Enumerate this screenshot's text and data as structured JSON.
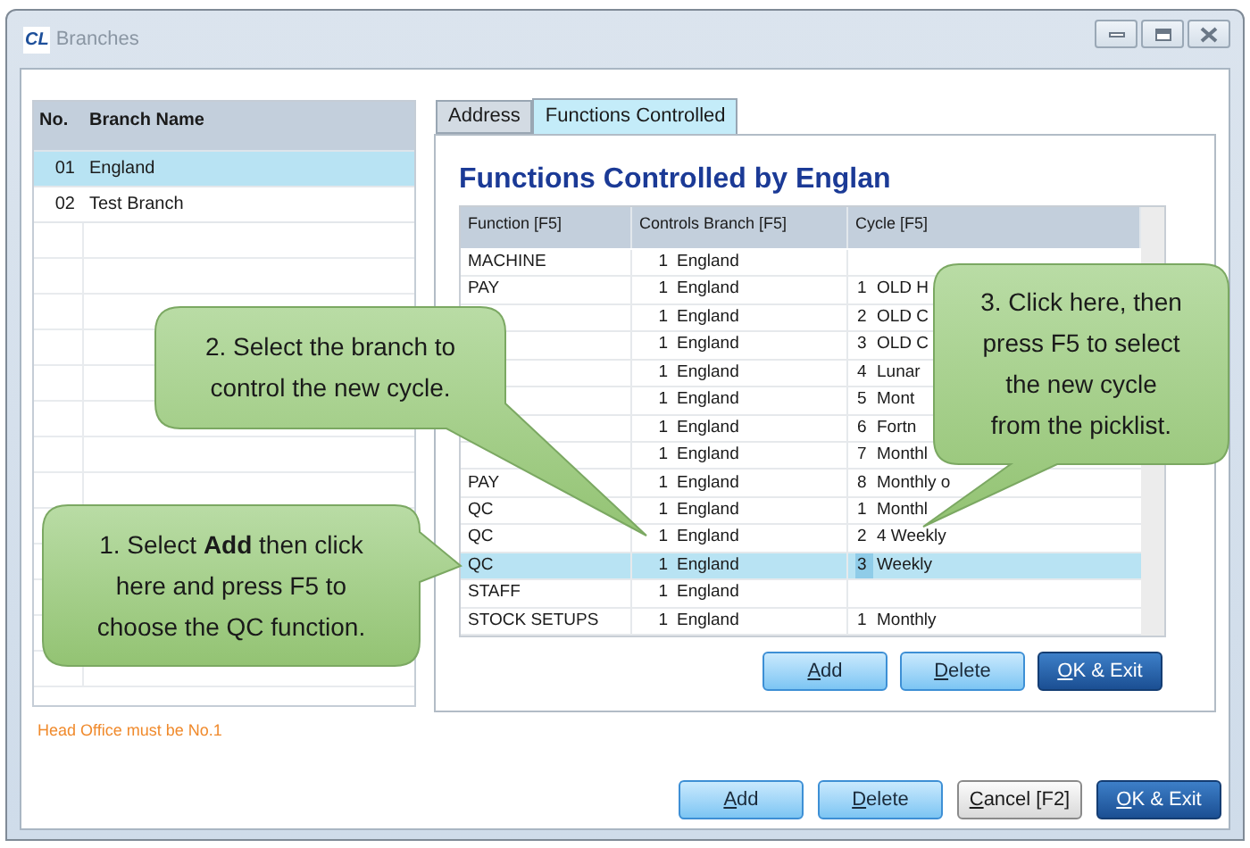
{
  "window": {
    "logo": "CL",
    "title": "Branches"
  },
  "branch_list": {
    "columns": [
      "No.",
      "Branch Name"
    ],
    "rows": [
      {
        "no": "01",
        "name": "England",
        "selected": true
      },
      {
        "no": "02",
        "name": "Test Branch",
        "selected": false
      }
    ]
  },
  "note": "Head Office must be No.1",
  "tabs": [
    {
      "label": "Address",
      "selected": false
    },
    {
      "label": "Functions Controlled",
      "selected": true
    }
  ],
  "heading": "Functions Controlled by Englan",
  "table": {
    "columns": [
      "Function [F5]",
      "Controls Branch [F5]",
      "Cycle [F5]"
    ],
    "rows": [
      {
        "function": "MACHINE",
        "branch_no": "1",
        "branch": "England",
        "cycle_no": "",
        "cycle": "",
        "selected": false
      },
      {
        "function": "PAY",
        "branch_no": "1",
        "branch": "England",
        "cycle_no": "1",
        "cycle": "OLD H",
        "selected": false
      },
      {
        "function": "",
        "branch_no": "1",
        "branch": "England",
        "cycle_no": "2",
        "cycle": "OLD C",
        "selected": false
      },
      {
        "function": "",
        "branch_no": "1",
        "branch": "England",
        "cycle_no": "3",
        "cycle": "OLD C",
        "selected": false
      },
      {
        "function": "",
        "branch_no": "1",
        "branch": "England",
        "cycle_no": "4",
        "cycle": "Lunar",
        "selected": false
      },
      {
        "function": "",
        "branch_no": "1",
        "branch": "England",
        "cycle_no": "5",
        "cycle": "Mont",
        "selected": false
      },
      {
        "function": "",
        "branch_no": "1",
        "branch": "England",
        "cycle_no": "6",
        "cycle": "Fortn",
        "selected": false
      },
      {
        "function": "",
        "branch_no": "1",
        "branch": "England",
        "cycle_no": "7",
        "cycle": "Monthl",
        "selected": false
      },
      {
        "function": "PAY",
        "branch_no": "1",
        "branch": "England",
        "cycle_no": "8",
        "cycle": "Monthly o",
        "selected": false
      },
      {
        "function": "QC",
        "branch_no": "1",
        "branch": "England",
        "cycle_no": "1",
        "cycle": "Monthl",
        "selected": false
      },
      {
        "function": "QC",
        "branch_no": "1",
        "branch": "England",
        "cycle_no": "2",
        "cycle": "4 Weekly",
        "selected": false
      },
      {
        "function": "QC",
        "branch_no": "1",
        "branch": "England",
        "cycle_no": "3",
        "cycle": "Weekly",
        "selected": true
      },
      {
        "function": "STAFF",
        "branch_no": "1",
        "branch": "England",
        "cycle_no": "",
        "cycle": "",
        "selected": false
      },
      {
        "function": "STOCK SETUPS",
        "branch_no": "1",
        "branch": "England",
        "cycle_no": "1",
        "cycle": "Monthly",
        "selected": false
      }
    ]
  },
  "panel_buttons": [
    {
      "label": "Add",
      "kind": "normal"
    },
    {
      "label": "Delete",
      "kind": "normal"
    },
    {
      "label": "OK & Exit",
      "kind": "primary"
    }
  ],
  "buttons": [
    {
      "label": "Add",
      "kind": "normal"
    },
    {
      "label": "Delete",
      "kind": "normal"
    },
    {
      "label": "Cancel [F2]",
      "kind": "cancel"
    },
    {
      "label": "OK & Exit",
      "kind": "primary"
    }
  ],
  "callouts": [
    {
      "lines": [
        "2. Select the branch to",
        "control the new cycle."
      ]
    },
    {
      "lines": [
        "3. Click here, then",
        "press F5 to select",
        "the new cycle",
        "from the picklist."
      ]
    },
    {
      "lines": [
        "1. Select **Add** then click",
        "here and press F5 to",
        "choose the QC function."
      ]
    }
  ]
}
